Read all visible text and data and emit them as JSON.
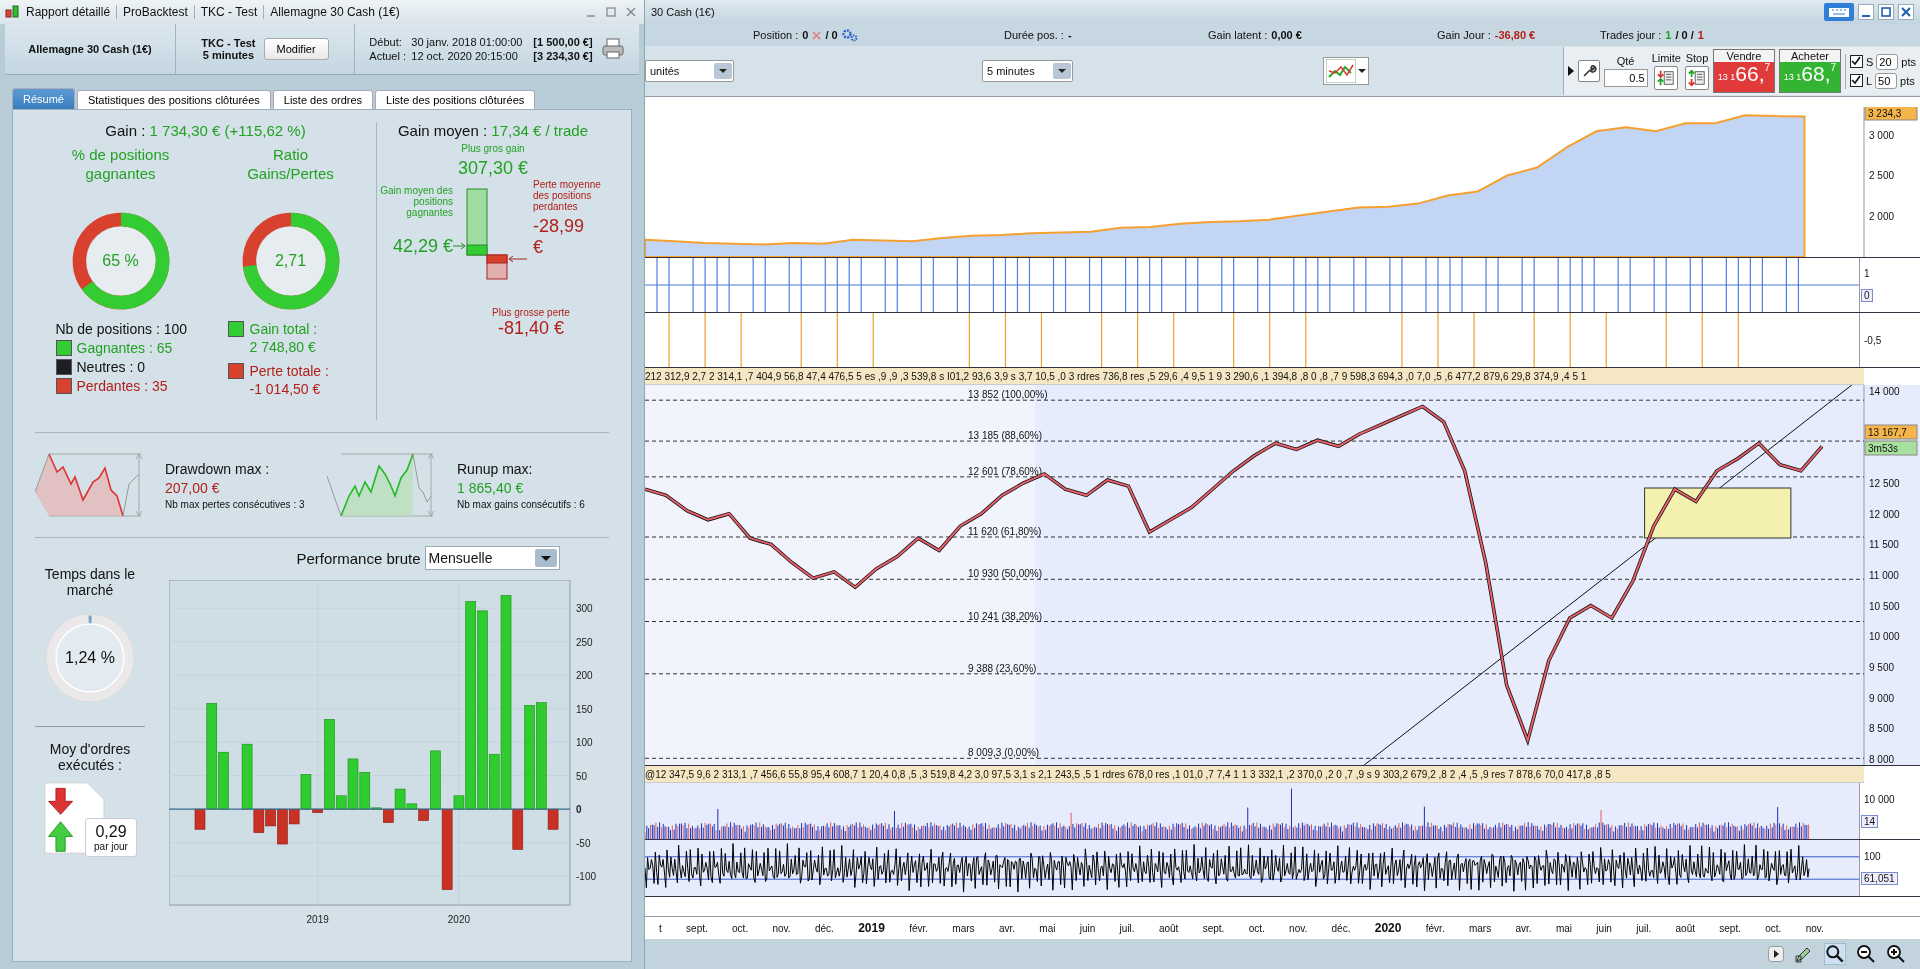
{
  "report": {
    "title_parts": [
      "Rapport détaillé",
      "ProBacktest",
      "TKC - Test",
      "Allemagne 30 Cash (1€)"
    ],
    "instrument": "Allemagne 30 Cash (1€)",
    "strategy": "TKC - Test",
    "timeframe": "5 minutes",
    "modify": "Modifier",
    "dates": [
      {
        "label": "Début:",
        "date": "30 janv. 2018 01:00:00",
        "amount": "[1 500,00 €]"
      },
      {
        "label": "Actuel :",
        "date": "12 oct. 2020 20:15:00",
        "amount": "[3 234,30 €]"
      }
    ],
    "tabs": [
      {
        "label": "Résumé",
        "selected": true
      },
      {
        "label": "Statistiques des positions clôturées",
        "selected": false
      },
      {
        "label": "Liste des ordres",
        "selected": false
      },
      {
        "label": "Liste des positions clôturées",
        "selected": false
      }
    ],
    "gain": {
      "label": "Gain :",
      "value": "1 734,30 € (+115,62 %)"
    },
    "donuts": [
      {
        "title": "% de positions gagnantes",
        "value": "65 %",
        "level": 0.65
      },
      {
        "title": "Ratio Gains/Pertes",
        "value": "2,71",
        "level": 0.73
      }
    ],
    "positions_count": "Nb de positions : 100",
    "breakdown": [
      {
        "label": "Gagnantes : 65",
        "kind": "win",
        "color": "#33cc33"
      },
      {
        "label": "Neutres : 0",
        "kind": "neutral",
        "color": "#1e1e24"
      },
      {
        "label": "Perdantes : 35",
        "kind": "loss",
        "color": "#d9412f"
      }
    ],
    "totals": [
      {
        "label": "Gain total :",
        "value": "2 748,80 €",
        "kind": "win",
        "color": "#33cc33"
      },
      {
        "label": "Perte totale :",
        "value": "-1 014,50 €",
        "kind": "loss",
        "color": "#d9412f"
      }
    ],
    "average": {
      "label": "Gain moyen :",
      "value": "17,34 € / trade",
      "best_label": "Plus gros gain",
      "best": "307,30 €",
      "avg_win_label": "Gain moyen des positions gagnantes",
      "avg_win": "42,29 €",
      "avg_loss_label": "Perte moyenne des positions perdantes",
      "avg_loss": "-28,99 €",
      "worst_label": "Plus grosse perte",
      "worst": "-81,40 €"
    },
    "extremes": [
      {
        "kind": "loss",
        "title": "Drawdown max :",
        "value": "207,00 €",
        "note": "Nb max pertes consécutives : 3"
      },
      {
        "kind": "win",
        "title": "Runup max:",
        "value": "1 865,40 €",
        "note": "Nb max gains consécutifs : 6"
      }
    ],
    "time_in_market": {
      "title": "Temps dans le marché",
      "value": "1,24 %",
      "level": 0.0124
    },
    "orders": {
      "title": "Moy d'ordres exécutés :",
      "value": "0,29",
      "unit": "par jour"
    },
    "performance": {
      "label": "Performance brute",
      "period": "Mensuelle",
      "chart_data": {
        "type": "bar",
        "categories": [
          null,
          null,
          null,
          null,
          null,
          null,
          null,
          null,
          null,
          null,
          "2019",
          null,
          null,
          null,
          null,
          null,
          null,
          null,
          null,
          null,
          null,
          null,
          "2020",
          null,
          null,
          null,
          null,
          null,
          null,
          null,
          null
        ],
        "values": [
          -30,
          158,
          85,
          0,
          97,
          -35,
          -25,
          -52,
          -22,
          52,
          -5,
          134,
          20,
          75,
          55,
          2,
          -20,
          30,
          8,
          -17,
          87,
          -120,
          20,
          310,
          296,
          82,
          319,
          -60,
          155,
          159,
          -30
        ],
        "ylim": [
          -143,
          342
        ],
        "grid": true,
        "ref_lines": [
          {
            "axis": "y",
            "value": 0
          }
        ],
        "yticks": [
          -100,
          -50,
          0,
          50,
          100,
          150,
          200,
          250,
          300
        ]
      }
    }
  },
  "platform": {
    "title": "30 Cash (1€)",
    "status": [
      {
        "kind": "position",
        "label": "Position :",
        "value": "0",
        "extra": "/ 0"
      },
      {
        "kind": "plain",
        "label": "Durée pos. :",
        "value": "-"
      },
      {
        "kind": "plain",
        "label": "Gain latent :",
        "value": "0,00 €"
      },
      {
        "kind": "loss",
        "label": "Gain Jour :",
        "value": "-36,80 €"
      },
      {
        "kind": "trades",
        "label": "Trades jour :",
        "parts": [
          {
            "text": "1",
            "kind": "win"
          },
          {
            "text": "/ 0 /",
            "kind": "plain"
          },
          {
            "text": "1",
            "kind": "loss"
          }
        ]
      }
    ],
    "quantity_mode": "unités",
    "interval": "5 minutes",
    "order": {
      "qty_label": "Qté",
      "qty": "0.5",
      "limit": "Limite",
      "stop": "Stop",
      "sides": [
        {
          "kind": "sell",
          "label": "Vendre",
          "head": "13 1",
          "big": "66,",
          "tail": "7"
        },
        {
          "kind": "buy",
          "label": "Acheter",
          "head": "13 1",
          "big": "68,",
          "tail": "7"
        }
      ],
      "brackets": [
        {
          "label": "S",
          "checked": true,
          "value": "20",
          "unit": "pts"
        },
        {
          "label": "L",
          "checked": true,
          "value": "50",
          "unit": "pts"
        }
      ]
    },
    "equity": {
      "tags": [
        {
          "label": "3 234,3",
          "kind": "price"
        }
      ],
      "chart_data": {
        "type": "area",
        "ylim": [
          1485,
          3353
        ],
        "series": [
          {
            "color": "#f5a030",
            "values": [
              1700,
              1680,
              1660,
              1650,
              1640,
              1660,
              1650,
              1700,
              1690,
              1680,
              1720,
              1750,
              1760,
              1780,
              1790,
              1800,
              1850,
              1860,
              1900,
              1920,
              1930,
              1950,
              2000,
              2050,
              2100,
              2110,
              2150,
              2250,
              2300,
              2500,
              2600,
              2850,
              3050,
              3100,
              3050,
              3150,
              3150,
              3250,
              3240,
              3234,
              null,
              null
            ]
          }
        ],
        "yticks": [
          {
            "value": 3000,
            "label": "3 000"
          },
          {
            "value": 2500,
            "label": "2 500"
          },
          {
            "value": 2000,
            "label": "2 000"
          }
        ]
      }
    },
    "signals": [
      {
        "kind": "long",
        "ticks": [
          {
            "label": "1",
            "kind": "tick"
          },
          {
            "label": "0",
            "kind": "current"
          }
        ]
      },
      {
        "kind": "short",
        "ticks": [
          {
            "label": "-0,5",
            "kind": "tick"
          }
        ]
      }
    ],
    "labels_top": "212 312,9 2,7 2 314,1 ,7 404,9 56,8 47,4 476,5 5 es ,9 ,9 ,3 539,8 s I01,2 93,6 3,9 s 3,7 10,5 ,0 3 rdres 736,8 res ,5 29,6 ,4 9,5 1 9 3 290,6 ,1 394,8 ,8 0 ,8 ,7 9 598,3 694,3 ,0 7,0 ,5 ,6 477,2 879,6 29,8 374,9 ,4 5 1",
    "price": {
      "tags": [
        {
          "label": "13 167,7",
          "kind": "price"
        },
        {
          "label": "3m53s",
          "kind": "timer"
        }
      ],
      "chart_data": {
        "type": "line",
        "ylim": [
          7900,
          14100
        ],
        "series": [
          {
            "color": "#e8606a",
            "values": [
              12400,
              12300,
              12050,
              11900,
              12000,
              11600,
              11500,
              11200,
              10950,
              11050,
              10800,
              11100,
              11300,
              11600,
              11400,
              11800,
              12000,
              12300,
              12500,
              12650,
              12400,
              12300,
              12550,
              12450,
              11700,
              11900,
              12100,
              12400,
              12700,
              12950,
              13150,
              13050,
              13200,
              13100,
              13300,
              13450,
              13600,
              13750,
              13500,
              12700,
              11200,
              9200,
              8300,
              9600,
              10300,
              10500,
              10300,
              10900,
              11800,
              12400,
              12200,
              12700,
              12900,
              13150,
              12800,
              12700,
              13100,
              null,
              null
            ]
          }
        ],
        "yticks": [
          {
            "value": 14000,
            "label": "14 000"
          },
          {
            "value": 12500,
            "label": "12 500"
          },
          {
            "value": 12000,
            "label": "12 000"
          },
          {
            "value": 11500,
            "label": "11 500"
          },
          {
            "value": 11000,
            "label": "11 000"
          },
          {
            "value": 10500,
            "label": "10 500"
          },
          {
            "value": 10000,
            "label": "10 000"
          },
          {
            "value": 9500,
            "label": "9 500"
          },
          {
            "value": 9000,
            "label": "9 000"
          },
          {
            "value": 8500,
            "label": "8 500"
          },
          {
            "value": 8000,
            "label": "8 000"
          }
        ],
        "ref_lines": [
          {
            "axis": "y",
            "value": 13852,
            "label": "13 852 (100,00%)"
          },
          {
            "axis": "y",
            "value": 13185,
            "label": "13 185 (88,60%)"
          },
          {
            "axis": "y",
            "value": 12601,
            "label": "12 601 (78,60%)"
          },
          {
            "axis": "y",
            "value": 11620,
            "label": "11 620 (61,80%)"
          },
          {
            "axis": "y",
            "value": 10930,
            "label": "10 930 (50,00%)"
          },
          {
            "axis": "y",
            "value": 10241,
            "label": "10 241 (38,20%)"
          },
          {
            "axis": "y",
            "value": 9388,
            "label": "9 388 (23,60%)"
          },
          {
            "axis": "y",
            "value": 8009.3,
            "label": "8 009,3 (0,00%)"
          }
        ]
      }
    },
    "labels_bottom": "@12 347,5 9,6 2 313,1 ,7 456,6 55,8 95,4 608,7 1 20,4 0,8 ,5 ,3 519,8 4,2 3,0 97,5 3,1 s 2,1 243,5 ,5 1 rdres 678,0 res ,1 01,0 ,7 7,4 1 1 3 332,1 ,2 370,0 ,2 0 ,7 ,9 s 9 303,2 679,2 ,8 2 ,4 ,5 ,9 res 7 878,6 70,0 417,8 ,8 5",
    "volume": {
      "ticks": [
        {
          "label": "10 000",
          "kind": "tick"
        },
        {
          "label": "14",
          "kind": "current"
        }
      ]
    },
    "oscillator": {
      "ticks": [
        {
          "label": "100",
          "kind": "tick"
        },
        {
          "label": "61,051",
          "kind": "current"
        }
      ]
    },
    "months": [
      {
        "label": "t",
        "kind": "month"
      },
      {
        "label": "sept.",
        "kind": "month"
      },
      {
        "label": "oct.",
        "kind": "month"
      },
      {
        "label": "nov.",
        "kind": "month"
      },
      {
        "label": "déc.",
        "kind": "month"
      },
      {
        "label": "2019",
        "kind": "year"
      },
      {
        "label": "févr.",
        "kind": "month"
      },
      {
        "label": "mars",
        "kind": "month"
      },
      {
        "label": "avr.",
        "kind": "month"
      },
      {
        "label": "mai",
        "kind": "month"
      },
      {
        "label": "juin",
        "kind": "month"
      },
      {
        "label": "juil.",
        "kind": "month"
      },
      {
        "label": "août",
        "kind": "month"
      },
      {
        "label": "sept.",
        "kind": "month"
      },
      {
        "label": "oct.",
        "kind": "month"
      },
      {
        "label": "nov.",
        "kind": "month"
      },
      {
        "label": "déc.",
        "kind": "month"
      },
      {
        "label": "2020",
        "kind": "year"
      },
      {
        "label": "févr.",
        "kind": "month"
      },
      {
        "label": "mars",
        "kind": "month"
      },
      {
        "label": "avr.",
        "kind": "month"
      },
      {
        "label": "mai",
        "kind": "month"
      },
      {
        "label": "juin",
        "kind": "month"
      },
      {
        "label": "juil.",
        "kind": "month"
      },
      {
        "label": "août",
        "kind": "month"
      },
      {
        "label": "sept.",
        "kind": "month"
      },
      {
        "label": "oct.",
        "kind": "month"
      },
      {
        "label": "nov.",
        "kind": "month"
      }
    ]
  }
}
